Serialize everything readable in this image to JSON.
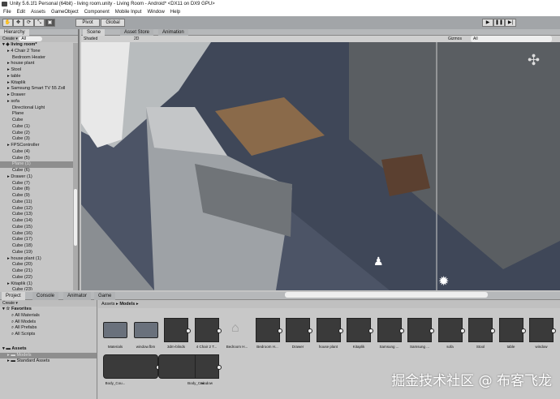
{
  "window": {
    "title": "Unity 5.6.1f1 Personal (64bit) - living room.unity - Living Room - Android* <DX11 on DX9 GPU>"
  },
  "menu": [
    "File",
    "Edit",
    "Assets",
    "GameObject",
    "Component",
    "Mobile Input",
    "Window",
    "Help"
  ],
  "toolbar": {
    "pivot": "Pivot",
    "global": "Global"
  },
  "hierarchy": {
    "tab": "Hierarchy",
    "create": "Create",
    "search": "All",
    "scene": "living room*",
    "items": [
      [
        "4 Chair 2 Tone",
        1
      ],
      [
        "Bedroom Heater",
        0
      ],
      [
        "house plant",
        1
      ],
      [
        "Stool",
        1
      ],
      [
        "table",
        1
      ],
      [
        "Kitaplik",
        1
      ],
      [
        "Samsung Smart TV 55 Zoll",
        1
      ],
      [
        "Drawer",
        1
      ],
      [
        "sofa",
        1
      ],
      [
        "Directional Light",
        0
      ],
      [
        "Plane",
        0
      ],
      [
        "Cube",
        0
      ],
      [
        "Cube (1)",
        0
      ],
      [
        "Cube (2)",
        0
      ],
      [
        "Cube (3)",
        0
      ],
      [
        "FPSController",
        1
      ],
      [
        "Cube (4)",
        0
      ],
      [
        "Cube (5)",
        0
      ],
      [
        "Plane (1)",
        0
      ],
      [
        "Cube (6)",
        0
      ],
      [
        "Drawer (1)",
        1
      ],
      [
        "Cube (7)",
        0
      ],
      [
        "Cube (8)",
        0
      ],
      [
        "Cube (9)",
        0
      ],
      [
        "Cube (11)",
        0
      ],
      [
        "Cube (12)",
        0
      ],
      [
        "Cube (13)",
        0
      ],
      [
        "Cube (14)",
        0
      ],
      [
        "Cube (15)",
        0
      ],
      [
        "Cube (16)",
        0
      ],
      [
        "Cube (17)",
        0
      ],
      [
        "Cube (18)",
        0
      ],
      [
        "Cube (19)",
        0
      ],
      [
        "house plant (1)",
        1
      ],
      [
        "Cube (20)",
        0
      ],
      [
        "Cube (21)",
        0
      ],
      [
        "Cube (22)",
        0
      ],
      [
        "Kitaplik (1)",
        1
      ],
      [
        "Cube (23)",
        0
      ]
    ],
    "selected": "Plane (1)"
  },
  "scene": {
    "tabs": [
      "Scene",
      "Asset Store",
      "Animation"
    ],
    "shading": "Shaded",
    "mode2d": "2D",
    "gizmos": "Gizmos",
    "search": "All"
  },
  "bottom_tabs": [
    "Project",
    "Console",
    "Animator",
    "Game"
  ],
  "project": {
    "create": "Create",
    "favorites": "Favorites",
    "fav_items": [
      "All Materials",
      "All Models",
      "All Prefabs",
      "All Scripts"
    ],
    "assets": "Assets",
    "asset_folders": [
      "Models",
      "Standard Assets"
    ],
    "selected": "Models"
  },
  "browser": {
    "breadcrumb": [
      "Assets",
      "Models"
    ],
    "items": [
      [
        "Materials",
        "folder"
      ],
      [
        "window.fbm",
        "folder"
      ],
      [
        "3dm-blinds",
        "model"
      ],
      [
        "4 Chair 2 T...",
        "model"
      ],
      [
        "Bedroom H...",
        "light"
      ],
      [
        "Bedroom H...",
        "model"
      ],
      [
        "Drawer",
        "model"
      ],
      [
        "house plant",
        "model"
      ],
      [
        "Kitaplik",
        "model"
      ],
      [
        "Samsung ...",
        "model"
      ],
      [
        "Samsung ...",
        "model"
      ],
      [
        "sofa",
        "model"
      ],
      [
        "Stool",
        "model"
      ],
      [
        "table",
        "model"
      ],
      [
        "window",
        "model"
      ],
      [
        "Body_Cou...",
        "wide"
      ],
      [
        "Body_Cou...",
        "wide"
      ],
      [
        "window",
        "model"
      ]
    ]
  },
  "watermark": "掘金技术社区 @ 布客飞龙"
}
